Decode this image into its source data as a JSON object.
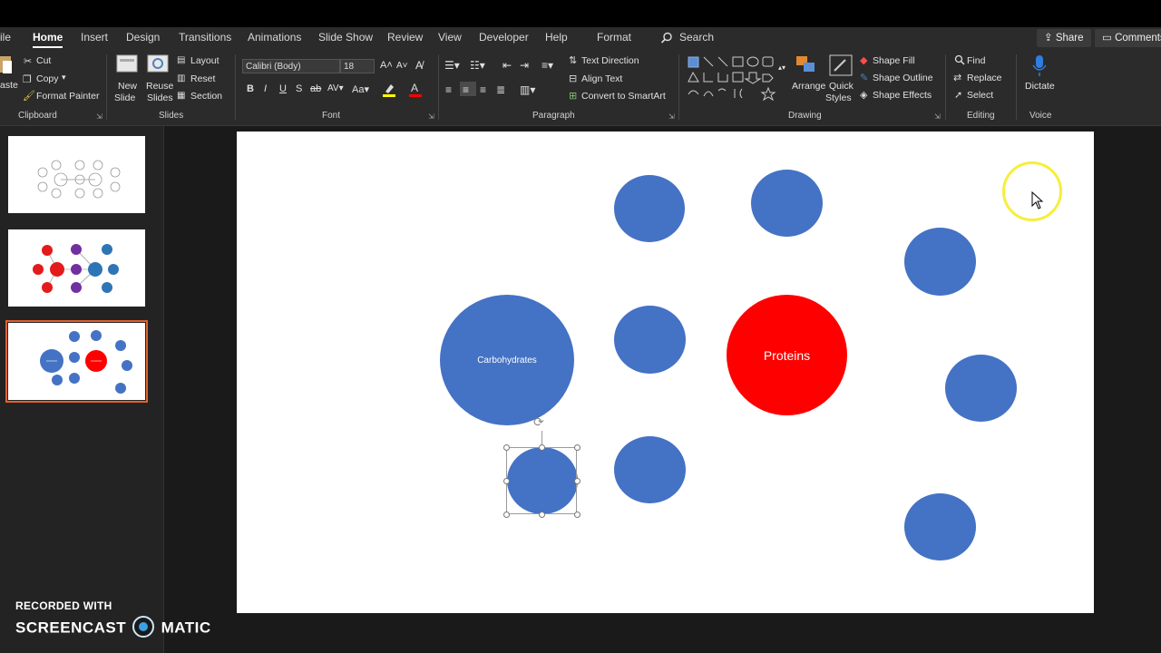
{
  "menubar": {
    "tabs": [
      {
        "label": "ile"
      },
      {
        "label": "Home"
      },
      {
        "label": "Insert"
      },
      {
        "label": "Design"
      },
      {
        "label": "Transitions"
      },
      {
        "label": "Animations"
      },
      {
        "label": "Slide Show"
      },
      {
        "label": "Review"
      },
      {
        "label": "View"
      },
      {
        "label": "Developer"
      },
      {
        "label": "Help"
      },
      {
        "label": "Format"
      }
    ],
    "search_label": "Search",
    "share_label": "Share",
    "comments_label": "Comments"
  },
  "ribbon": {
    "clipboard": {
      "paste": "aste",
      "cut": "Cut",
      "copy": "Copy",
      "format_painter": "Format Painter",
      "group": "Clipboard"
    },
    "slides": {
      "new_slide": "New",
      "new_slide2": "Slide",
      "reuse": "Reuse",
      "reuse2": "Slides",
      "layout": "Layout",
      "reset": "Reset",
      "section": "Section",
      "group": "Slides"
    },
    "font": {
      "family": "Calibri (Body)",
      "size": "18",
      "group": "Font"
    },
    "paragraph": {
      "text_direction": "Text Direction",
      "align_text": "Align Text",
      "convert_smartart": "Convert to SmartArt",
      "group": "Paragraph"
    },
    "drawing": {
      "arrange": "Arrange",
      "quick_styles": "Quick",
      "quick_styles2": "Styles",
      "shape_fill": "Shape Fill",
      "shape_outline": "Shape Outline",
      "shape_effects": "Shape Effects",
      "group": "Drawing"
    },
    "editing": {
      "find": "Find",
      "replace": "Replace",
      "select": "Select",
      "group": "Editing"
    },
    "voice": {
      "dictate": "Dictate",
      "group": "Voice"
    }
  },
  "slide": {
    "carbohydrates_label": "Carbohydrates",
    "proteins_label": "Proteins"
  },
  "colors": {
    "shape_blue": "#4472c4",
    "shape_red": "#ff0000",
    "selection_orange": "#e0612f",
    "cursor_highlight": "#f5ef3a"
  },
  "watermark": {
    "line1": "RECORDED WITH",
    "line2a": "SCREENCAST",
    "line2b": "MATIC"
  }
}
